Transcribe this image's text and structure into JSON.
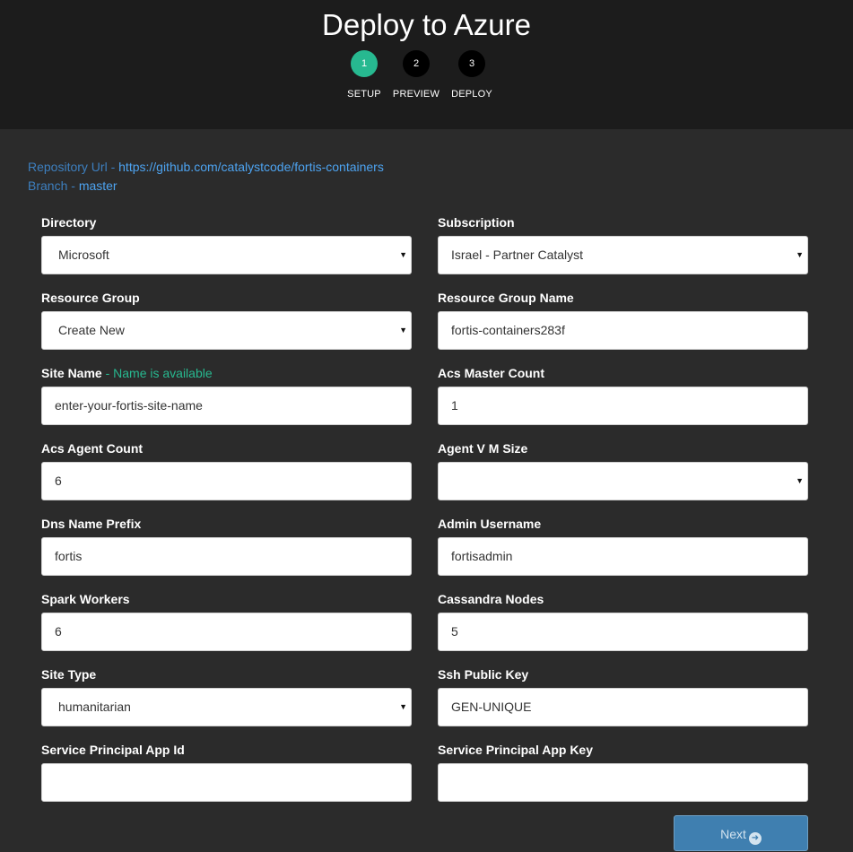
{
  "header": {
    "title": "Deploy to Azure",
    "steps": [
      {
        "number": "1",
        "label": "SETUP",
        "active": true
      },
      {
        "number": "2",
        "label": "PREVIEW",
        "active": false
      },
      {
        "number": "3",
        "label": "DEPLOY",
        "active": false
      }
    ]
  },
  "repo": {
    "url_label": "Repository Url - ",
    "url_value": "https://github.com/catalystcode/fortis-containers",
    "branch_label": "Branch - ",
    "branch_value": "master"
  },
  "form": {
    "directory": {
      "label": "Directory",
      "value": "Microsoft"
    },
    "subscription": {
      "label": "Subscription",
      "value": "Israel - Partner Catalyst"
    },
    "resource_group": {
      "label": "Resource Group",
      "value": "Create New"
    },
    "resource_group_name": {
      "label": "Resource Group Name",
      "value": "fortis-containers283f"
    },
    "site_name": {
      "label": "Site Name",
      "note": " - Name is available",
      "value": "enter-your-fortis-site-name"
    },
    "acs_master_count": {
      "label": "Acs Master Count",
      "value": "1"
    },
    "acs_agent_count": {
      "label": "Acs Agent Count",
      "value": "6"
    },
    "agent_vm_size": {
      "label": "Agent V M Size",
      "value": ""
    },
    "dns_name_prefix": {
      "label": "Dns Name Prefix",
      "value": "fortis"
    },
    "admin_username": {
      "label": "Admin Username",
      "value": "fortisadmin"
    },
    "spark_workers": {
      "label": "Spark Workers",
      "value": "6"
    },
    "cassandra_nodes": {
      "label": "Cassandra Nodes",
      "value": "5"
    },
    "site_type": {
      "label": "Site Type",
      "value": "humanitarian"
    },
    "ssh_public_key": {
      "label": "Ssh Public Key",
      "value": "GEN-UNIQUE"
    },
    "sp_app_id": {
      "label": "Service Principal App Id",
      "value": ""
    },
    "sp_app_key": {
      "label": "Service Principal App Key",
      "value": ""
    }
  },
  "actions": {
    "next_label": "Next",
    "next_icon": "arrow-right-circle-icon"
  },
  "colors": {
    "accent": "#27b990",
    "link": "#4da3f0",
    "header_bg": "#1c1c1c",
    "page_bg": "#2b2b2b",
    "button_bg": "#3f7fb0"
  }
}
